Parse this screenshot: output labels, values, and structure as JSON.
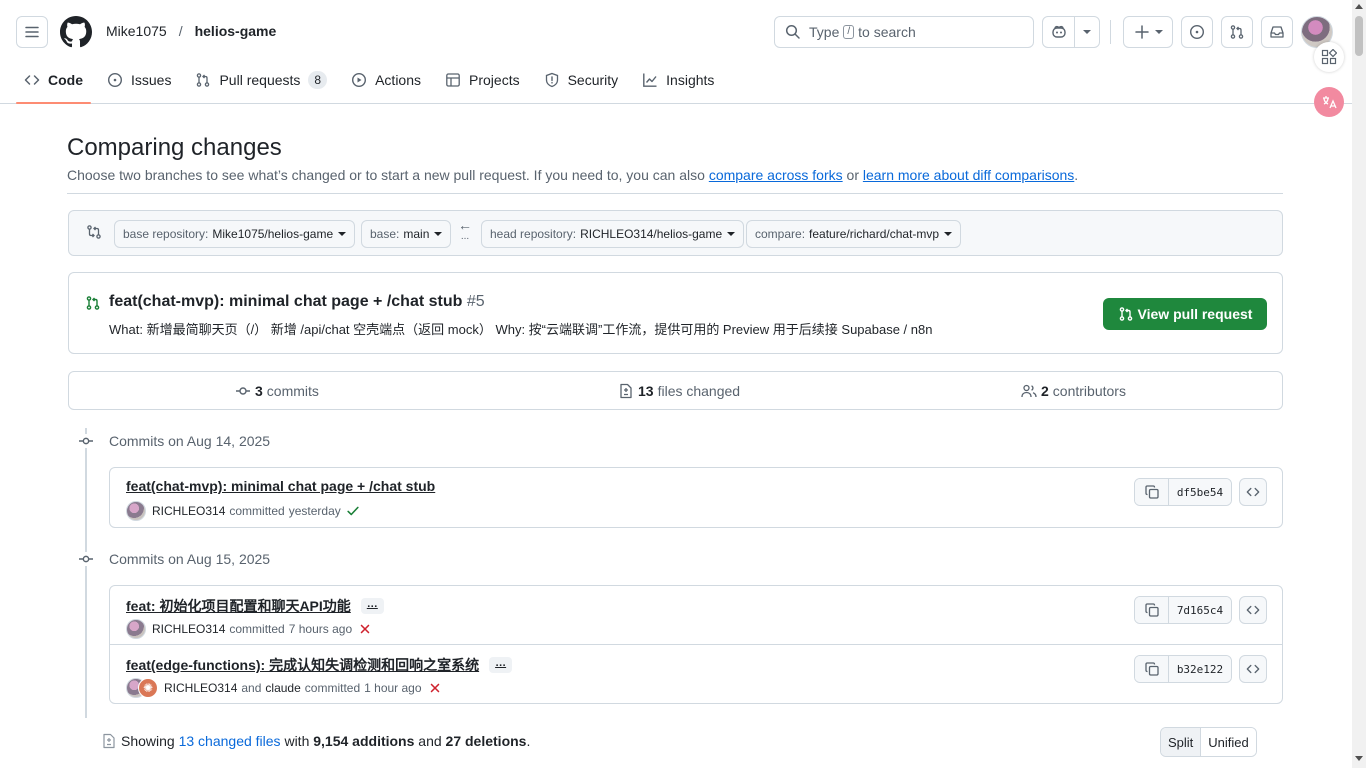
{
  "header": {
    "owner": "Mike1075",
    "separator": "/",
    "repo": "helios-game",
    "search_placeholder_prefix": "Type",
    "search_kbd": "/",
    "search_placeholder_suffix": "to search"
  },
  "tabs": [
    {
      "label": "Code",
      "icon": "code-icon",
      "selected": true
    },
    {
      "label": "Issues",
      "icon": "issue-opened-icon"
    },
    {
      "label": "Pull requests",
      "icon": "git-pull-request-icon",
      "count": "8"
    },
    {
      "label": "Actions",
      "icon": "play-icon"
    },
    {
      "label": "Projects",
      "icon": "table-icon"
    },
    {
      "label": "Security",
      "icon": "shield-icon"
    },
    {
      "label": "Insights",
      "icon": "graph-icon"
    }
  ],
  "page": {
    "title": "Comparing changes",
    "subtitle_text": "Choose two branches to see what’s changed or to start a new pull request. If you need to, you can also",
    "compare_forks_link": "compare across forks",
    "or_text": "or",
    "learn_more_link": "learn more about diff comparisons",
    "period": "."
  },
  "range": {
    "base_repo_label": "base repository:",
    "base_repo_value": "Mike1075/helios-game",
    "base_label": "base:",
    "base_value": "main",
    "head_repo_label": "head repository:",
    "head_repo_value": "RICHLEO314/helios-game",
    "compare_label": "compare:",
    "compare_value": "feature/richard/chat-mvp",
    "arrow": "←",
    "arrow_dots": "..."
  },
  "pull_request": {
    "title": "feat(chat-mvp): minimal chat page + /chat stub",
    "number": "#5",
    "description": "What: 新增最简聊天页（/） 新增 /api/chat 空壳端点（返回 mock） Why: 按“云端联调”工作流，提供可用的 Preview 用于后续接 Supabase / n8n",
    "button_label": "View pull request"
  },
  "stats": {
    "commits_count": "3",
    "commits_label": "commits",
    "files_count": "13",
    "files_label": "files changed",
    "contributors_count": "2",
    "contributors_label": "contributors"
  },
  "commit_groups": [
    {
      "date": "Commits on Aug 14, 2025",
      "commits": [
        {
          "message": "feat(chat-mvp): minimal chat page + /chat stub",
          "author": "RICHLEO314",
          "verb": "committed",
          "time": "yesterday",
          "status": "success",
          "sha": "df5be54"
        }
      ]
    },
    {
      "date": "Commits on Aug 15, 2025",
      "commits": [
        {
          "message": "feat: 初始化项目配置和聊天API功能",
          "ellipsis": "…",
          "author": "RICHLEO314",
          "verb": "committed",
          "time": "7 hours ago",
          "status": "failure",
          "sha": "7d165c4"
        },
        {
          "message": "feat(edge-functions): 完成认知失调检测和回响之室系统",
          "ellipsis": "…",
          "author": "RICHLEO314",
          "and_text": "and",
          "coauthor": "claude",
          "verb": "committed",
          "time": "1 hour ago",
          "status": "failure",
          "sha": "b32e122"
        }
      ]
    }
  ],
  "summary": {
    "showing": "Showing",
    "changed_files_link": "13 changed files",
    "with": "with",
    "additions": "9,154 additions",
    "and": "and",
    "deletions": "27 deletions",
    "period": "."
  },
  "view_toggle": {
    "split": "Split",
    "unified": "Unified",
    "selected": "Unified"
  },
  "colors": {
    "accent": "#0969da",
    "primary_button": "#1f883d",
    "success": "#1a7f37",
    "danger": "#cf222e",
    "tab_underline": "#fd8c73"
  }
}
